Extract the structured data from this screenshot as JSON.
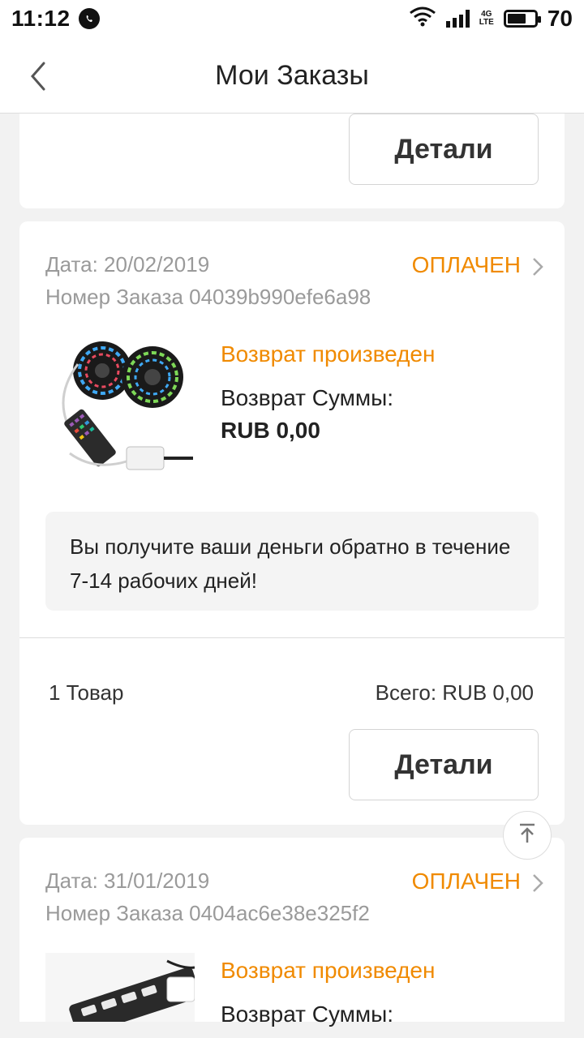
{
  "status_bar": {
    "time": "11:12",
    "battery": "70",
    "network": "4G",
    "network_sub": "LTE"
  },
  "header": {
    "title": "Мои Заказы"
  },
  "orders": [
    {
      "details_label": "Детали"
    },
    {
      "date": "Дата: 20/02/2019",
      "order_number": "Номер Заказа 04039b990efe6a98",
      "status": "ОПЛАЧЕН",
      "return_title": "Возврат произведен",
      "return_label": "Возврат Суммы:",
      "return_amount": "RUB 0,00",
      "note": "Вы получите ваши деньги обратно в течение 7-14 рабочих дней!",
      "items_count": "1 Товар",
      "total": "Всего: RUB 0,00",
      "details_label": "Детали"
    },
    {
      "date": "Дата: 31/01/2019",
      "order_number": "Номер Заказа 0404ac6e38e325f2",
      "status": "ОПЛАЧЕН",
      "return_title": "Возврат произведен",
      "return_label": "Возврат Суммы:"
    }
  ],
  "colors": {
    "accent": "#f08a00",
    "meta_text": "#9a9a9a",
    "background": "#f2f2f2"
  }
}
